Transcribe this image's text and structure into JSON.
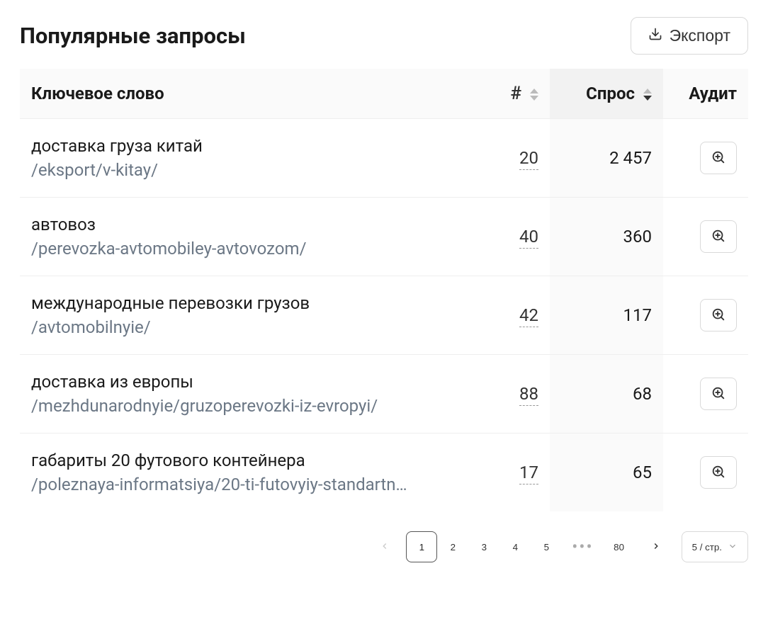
{
  "header": {
    "title": "Популярные запросы",
    "export_label": "Экспорт"
  },
  "columns": {
    "keyword": "Ключевое слово",
    "num_symbol": "#",
    "demand": "Спрос",
    "audit": "Аудит"
  },
  "rows": [
    {
      "keyword": "доставка груза китай",
      "path": "/eksport/v-kitay/",
      "num": "20",
      "demand": "2 457"
    },
    {
      "keyword": "автовоз",
      "path": "/perevozka-avtomobiley-avtovozom/",
      "num": "40",
      "demand": "360"
    },
    {
      "keyword": "международные перевозки грузов",
      "path": "/avtomobilnyie/",
      "num": "42",
      "demand": "117"
    },
    {
      "keyword": "доставка из европы",
      "path": "/mezhdunarodnyie/gruzoperevozki-iz-evropyi/",
      "num": "88",
      "demand": "68"
    },
    {
      "keyword": "габариты 20 футового контейнера",
      "path": "/poleznaya-informatsiya/20-ti-futovyiy-standartn…",
      "num": "17",
      "demand": "65"
    }
  ],
  "pagination": {
    "pages": [
      "1",
      "2",
      "3",
      "4",
      "5"
    ],
    "last_page": "80",
    "current": "1",
    "page_size_label": "5 / стр."
  }
}
